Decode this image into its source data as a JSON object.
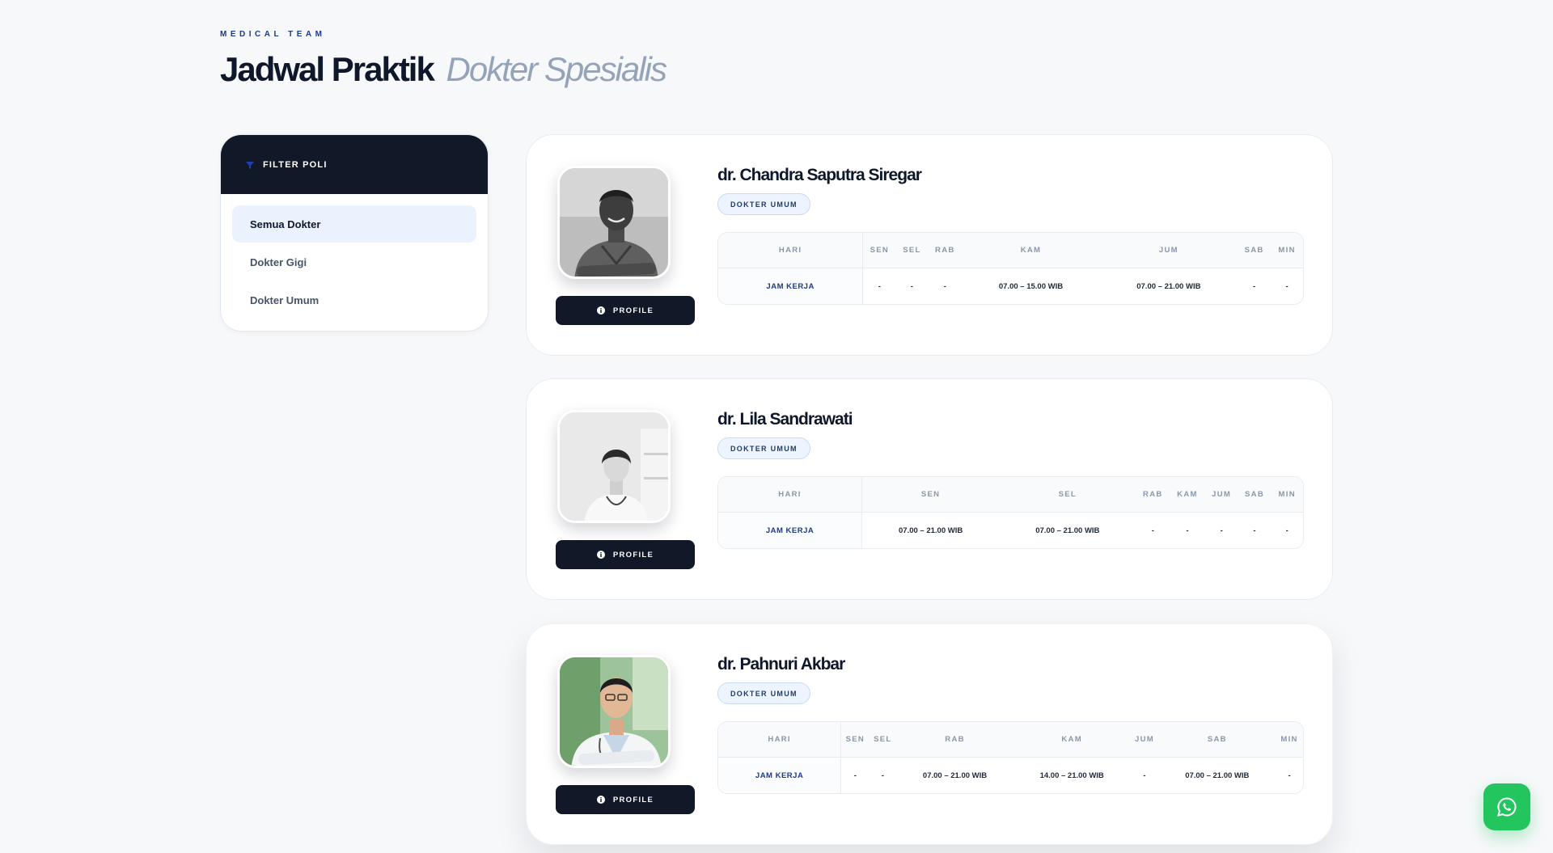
{
  "header": {
    "eyebrow": "MEDICAL TEAM",
    "title_strong": "Jadwal Praktik",
    "title_light": "Dokter Spesialis"
  },
  "sidebar": {
    "title": "FILTER POLI",
    "items": [
      {
        "label": "Semua Dokter",
        "active": true
      },
      {
        "label": "Dokter Gigi",
        "active": false
      },
      {
        "label": "Dokter Umum",
        "active": false
      }
    ]
  },
  "schedule_header_label": "HARI",
  "schedule_row_label": "JAM KERJA",
  "profile_button_label": "PROFILE",
  "days": [
    "SEN",
    "SEL",
    "RAB",
    "KAM",
    "JUM",
    "SAB",
    "MIN"
  ],
  "doctors": [
    {
      "name": "dr. Chandra Saputra Siregar",
      "badge": "DOKTER UMUM",
      "hours": [
        "-",
        "-",
        "-",
        "07.00 – 15.00 WIB",
        "07.00 – 21.00 WIB",
        "-",
        "-"
      ]
    },
    {
      "name": "dr. Lila Sandrawati",
      "badge": "DOKTER UMUM",
      "hours": [
        "07.00 – 21.00 WIB",
        "07.00 – 21.00 WIB",
        "-",
        "-",
        "-",
        "-",
        "-"
      ]
    },
    {
      "name": "dr. Pahnuri Akbar",
      "badge": "DOKTER UMUM",
      "hours": [
        "-",
        "-",
        "07.00 – 21.00 WIB",
        "14.00 – 21.00 WIB",
        "-",
        "07.00 – 21.00 WIB",
        "-"
      ]
    }
  ],
  "colors": {
    "background": "#f7f8fa",
    "dark": "#111827",
    "accent": "#1e3a8a",
    "whatsapp": "#22c55e"
  },
  "icons": {
    "filter": "filter-icon",
    "info": "info-icon",
    "whatsapp": "whatsapp-icon"
  }
}
